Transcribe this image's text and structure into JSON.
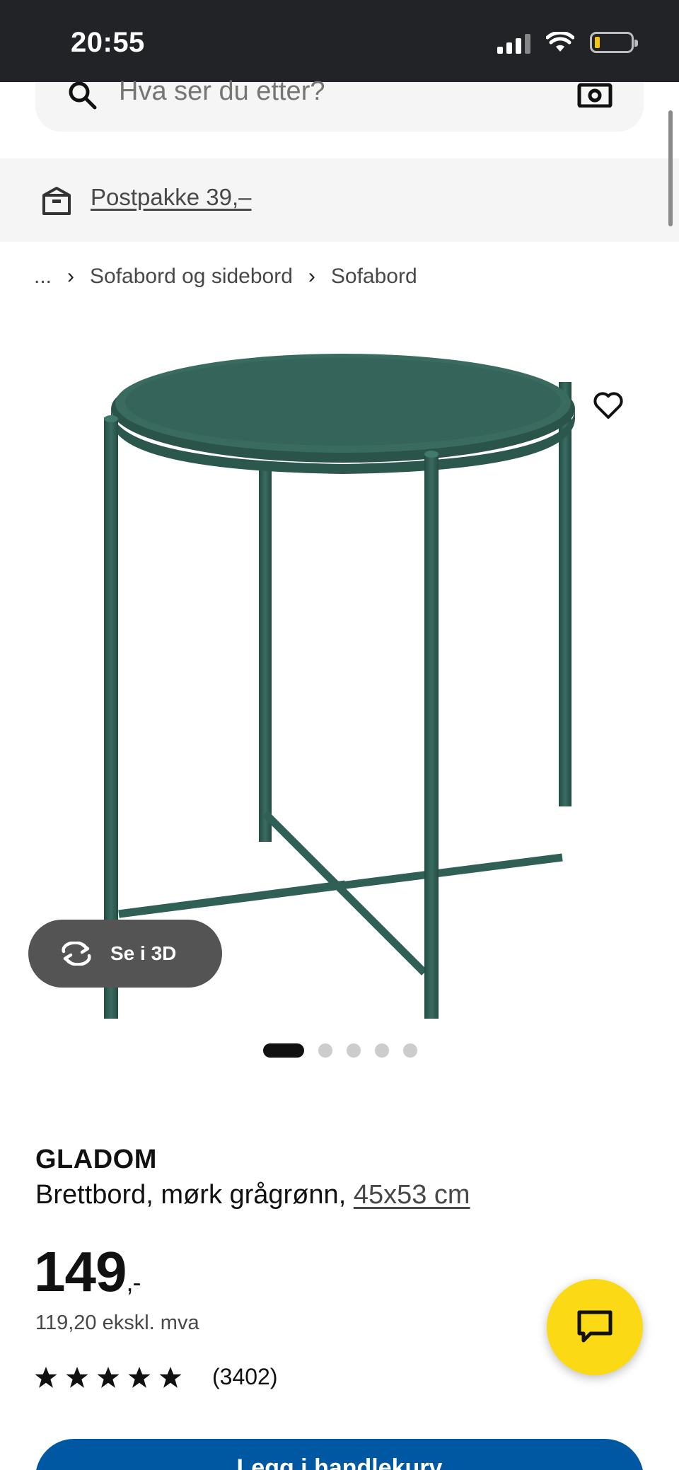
{
  "status_bar": {
    "time": "20:55"
  },
  "search": {
    "placeholder": "Hva ser du etter?"
  },
  "banner": {
    "link_text": "Postpakke 39,–"
  },
  "breadcrumb": {
    "ellipsis": "...",
    "items": [
      "Sofabord og sidebord",
      "Sofabord"
    ]
  },
  "product": {
    "name": "GLADOM",
    "description": "Brettbord, mørk grågrønn, ",
    "size": "45x53 cm",
    "price": "149",
    "price_suffix": ",-",
    "price_ex_vat": "119,20 ekskl. mva",
    "rating_count": "(3402)",
    "rating_stars": 5
  },
  "view3d": {
    "label": "Se i 3D"
  },
  "carousel": {
    "total": 5,
    "active": 1
  },
  "cart": {
    "label": "Legg i handlekurv"
  },
  "colors": {
    "accent_yellow": "#fbd914",
    "brand_blue": "#0058a3",
    "product_green": "#2f5f55"
  },
  "icons": [
    "search-icon",
    "camera-icon",
    "box-icon",
    "heart-icon",
    "rotate-3d-icon",
    "star-icon",
    "chat-icon"
  ]
}
